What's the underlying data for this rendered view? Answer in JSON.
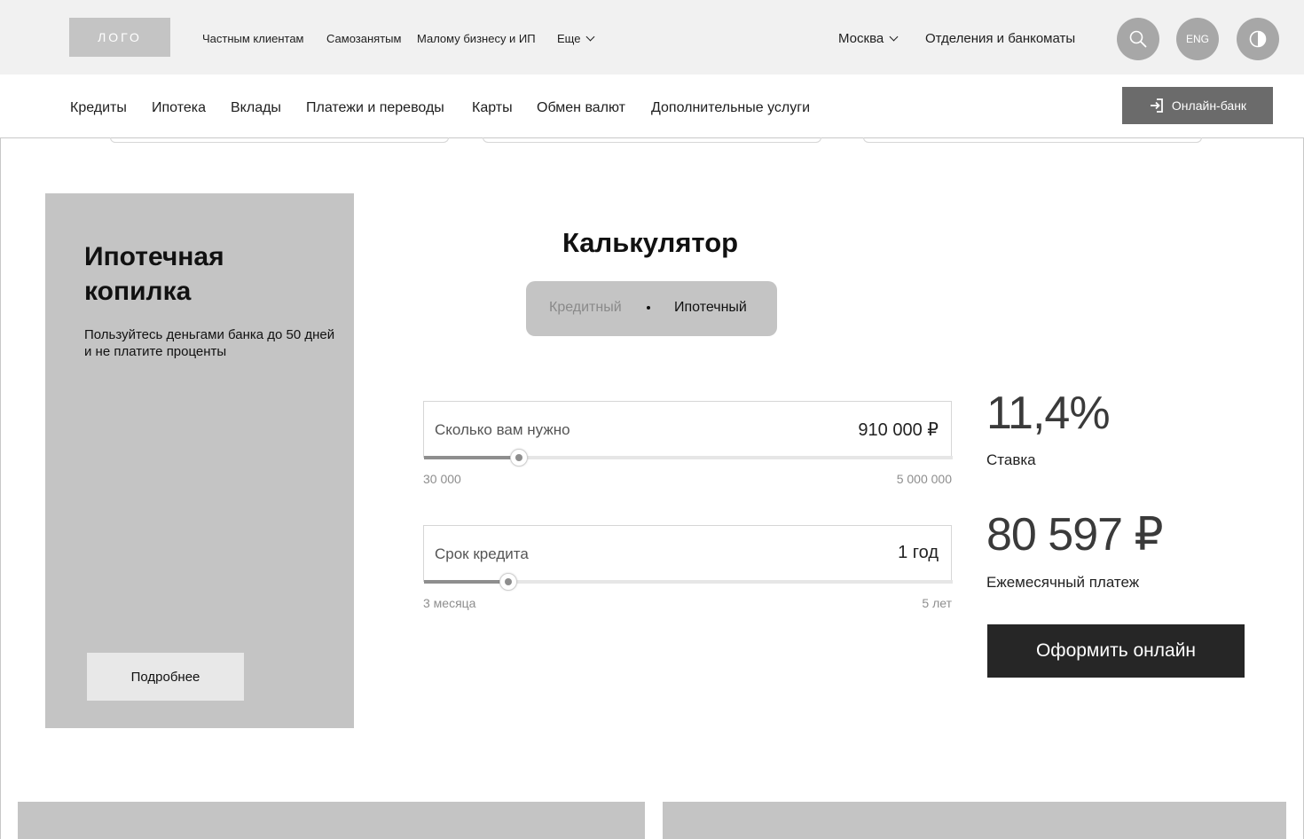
{
  "header": {
    "logo_text": "ЛОГО",
    "segments": [
      {
        "label": "Частным клиентам"
      },
      {
        "label": "Самозанятым"
      },
      {
        "label": "Малому бизнесу и ИП"
      },
      {
        "label": "Еще"
      }
    ],
    "city": "Москва",
    "branches_link": "Отделения и банкоматы",
    "lang_button": "ENG",
    "icons": [
      "search-icon",
      "contrast-icon",
      "chevron-down-icon"
    ]
  },
  "menu": {
    "items": [
      {
        "label": "Кредиты"
      },
      {
        "label": "Ипотека"
      },
      {
        "label": "Вклады"
      },
      {
        "label": "Платежи и переводы"
      },
      {
        "label": "Карты"
      },
      {
        "label": "Обмен валют"
      },
      {
        "label": "Дополнительные услуги"
      }
    ],
    "online_bank": "Онлайн-банк"
  },
  "promo": {
    "title": "Ипотечная копилка",
    "text": "Пользуйтесь деньгами банка до 50 дней и не платите проценты",
    "button": "Подробнее"
  },
  "calculator": {
    "title": "Калькулятор",
    "switch": {
      "options": [
        "Кредитный",
        "Ипотечный"
      ],
      "selected": "Ипотечный"
    },
    "amount": {
      "label": "Сколько вам нужно",
      "value": "910 000 ₽",
      "min": "30 000",
      "max": "5 000 000",
      "slider_fraction": 0.18
    },
    "term": {
      "label": "Срок кредита",
      "value": "1 год",
      "min": "3 месяца",
      "max": "5 лет",
      "slider_fraction": 0.16
    },
    "rate": {
      "value": "11,4%",
      "caption": "Ставка"
    },
    "payment": {
      "value": "80 597 ₽",
      "caption": "Ежемесячный платеж"
    },
    "apply_button": "Оформить онлайн"
  },
  "colors": {
    "topbar_bg": "#f1f1f1",
    "placeholder_gray": "#c4c4c4",
    "online_bank_bg": "#6b6b6b",
    "apply_bg": "#262626"
  }
}
